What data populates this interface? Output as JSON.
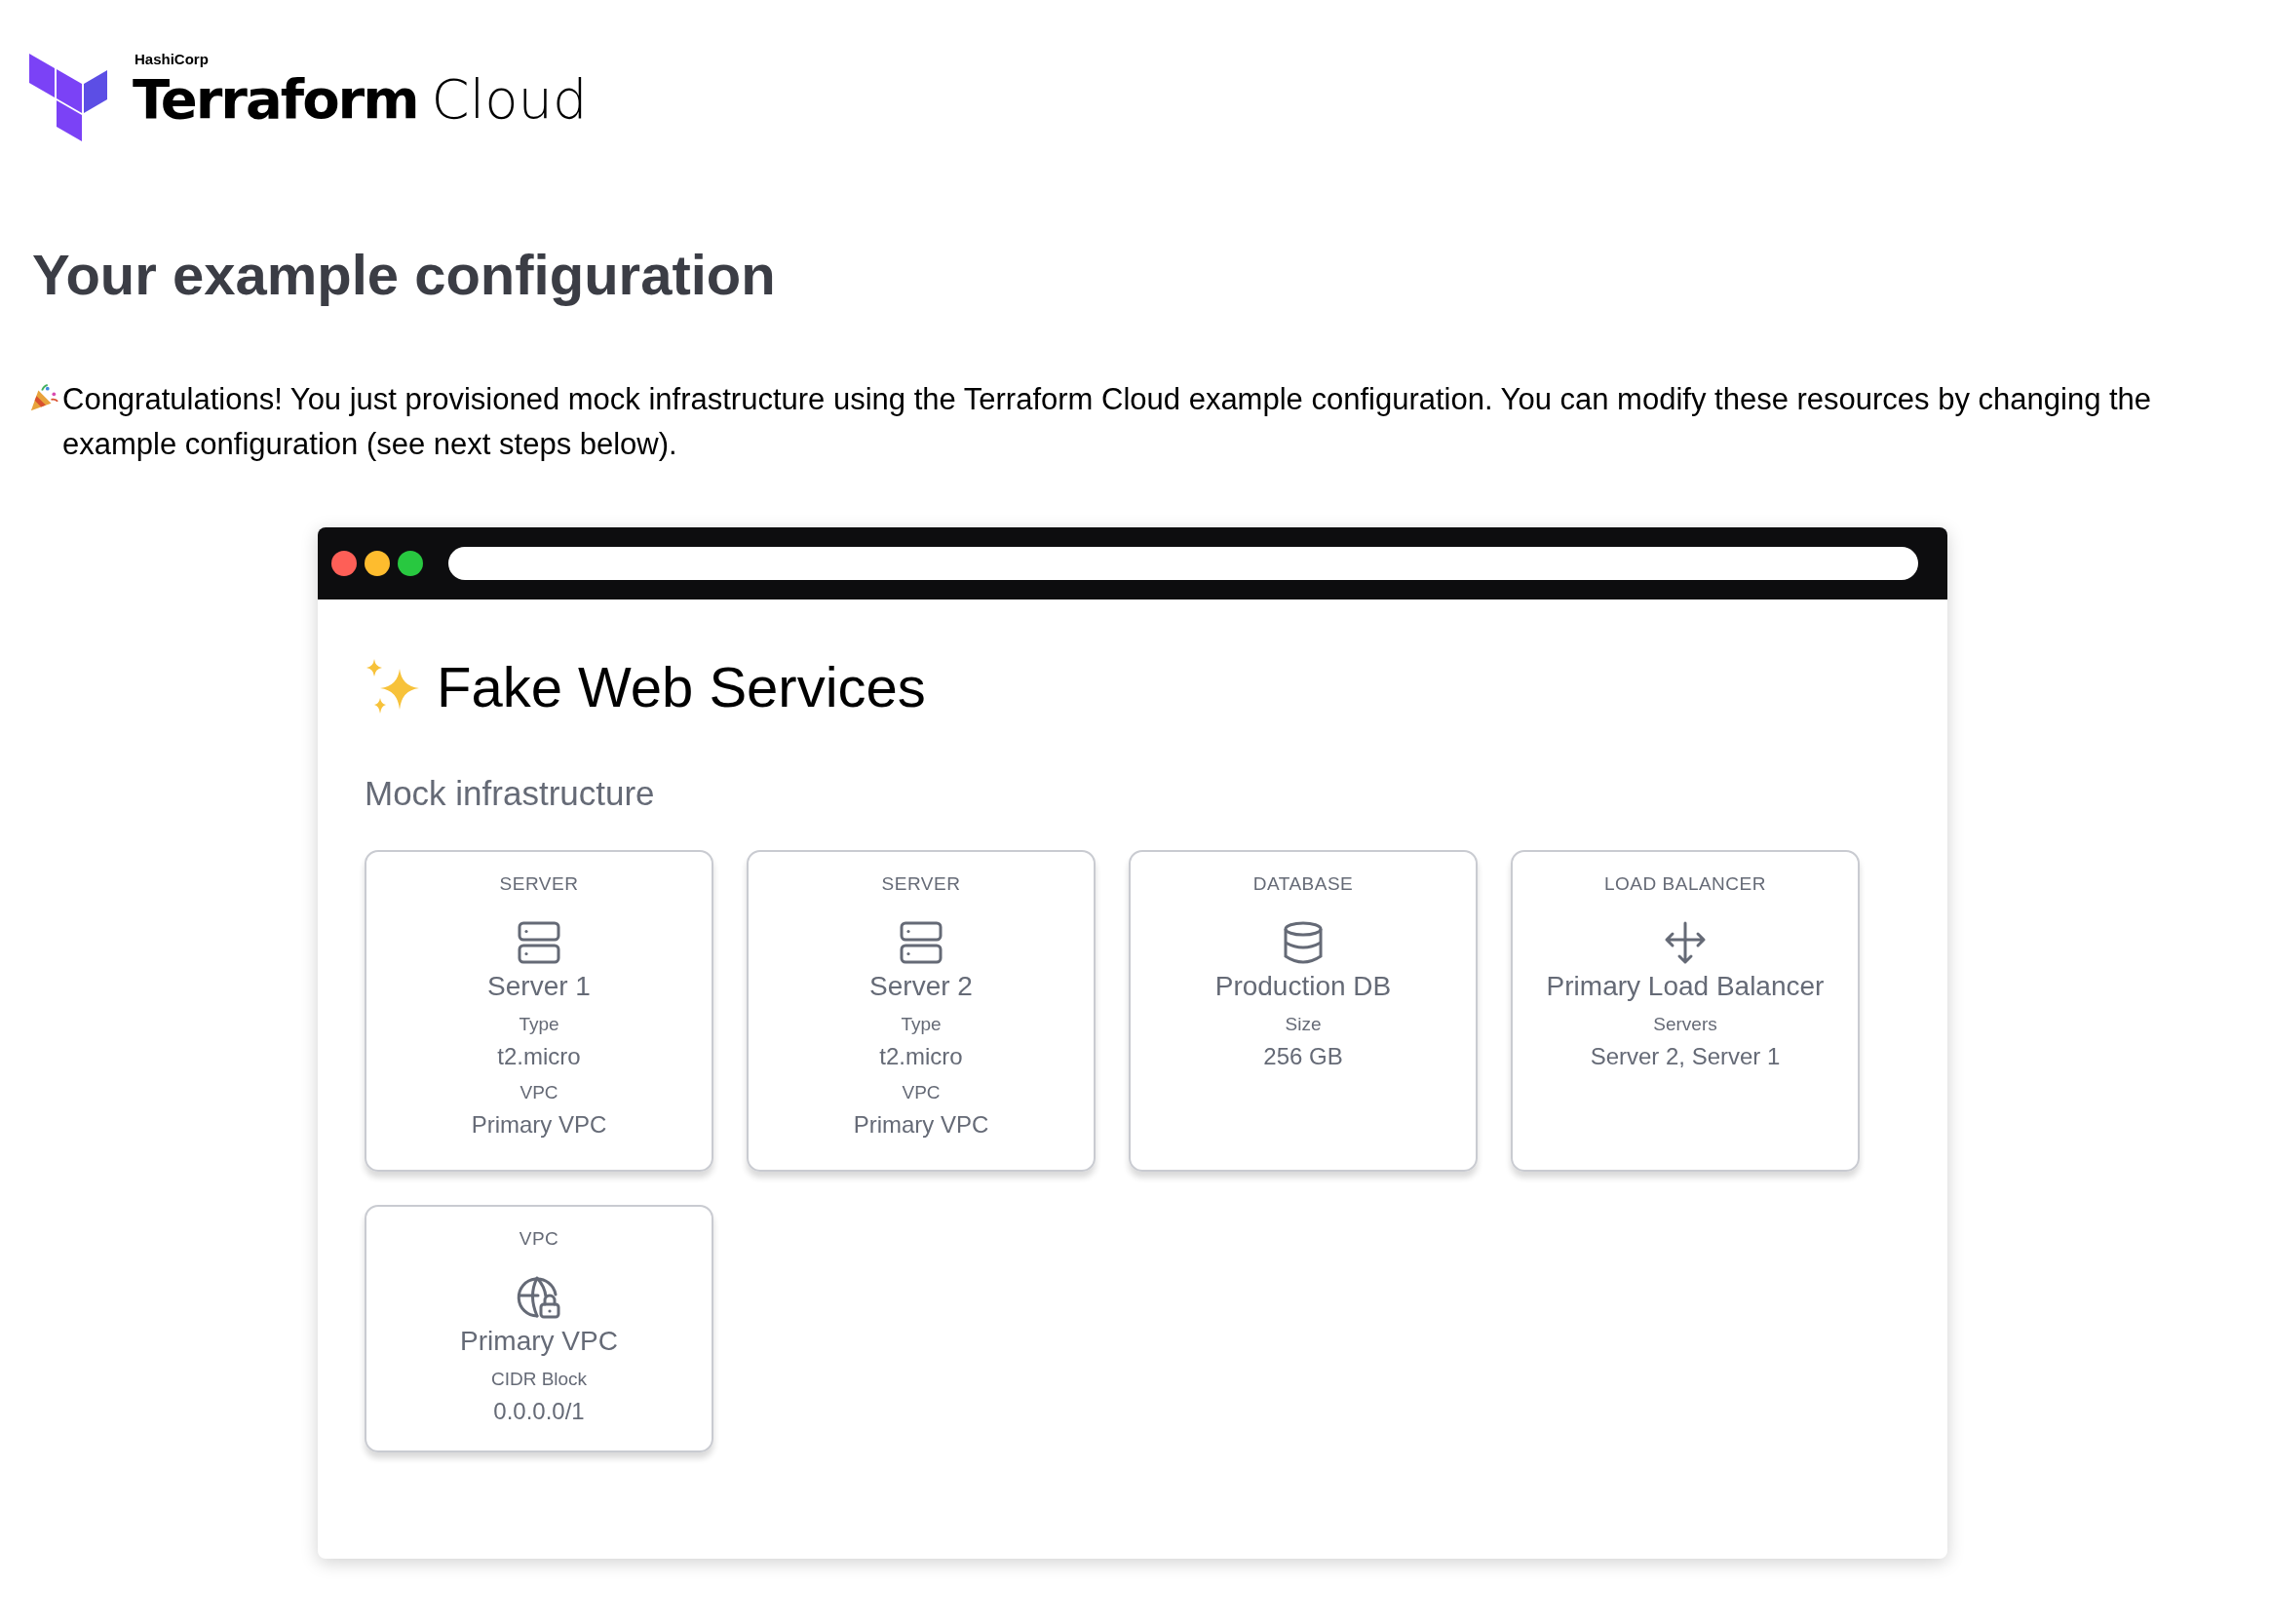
{
  "logo": {
    "company": "HashiCorp",
    "product": "Terraform",
    "edition": "Cloud"
  },
  "heading": "Your example configuration",
  "intro": "Congratulations! You just provisioned mock infrastructure using the Terraform Cloud example configuration. You can modify these resources by changing the example configuration (see next steps below).",
  "browser": {
    "title": "Fake Web Services",
    "section": "Mock infrastructure",
    "resources": [
      {
        "kind": "server",
        "category": "SERVER",
        "name": "Server 1",
        "fields": [
          {
            "label": "Type",
            "value": "t2.micro"
          },
          {
            "label": "VPC",
            "value": "Primary VPC"
          }
        ]
      },
      {
        "kind": "server",
        "category": "SERVER",
        "name": "Server 2",
        "fields": [
          {
            "label": "Type",
            "value": "t2.micro"
          },
          {
            "label": "VPC",
            "value": "Primary VPC"
          }
        ]
      },
      {
        "kind": "database",
        "category": "DATABASE",
        "name": "Production DB",
        "fields": [
          {
            "label": "Size",
            "value": "256 GB"
          }
        ]
      },
      {
        "kind": "load_balancer",
        "category": "LOAD BALANCER",
        "name": "Primary Load Balancer",
        "fields": [
          {
            "label": "Servers",
            "value": "Server 2, Server 1"
          }
        ]
      },
      {
        "kind": "vpc",
        "category": "VPC",
        "name": "Primary VPC",
        "fields": [
          {
            "label": "CIDR Block",
            "value": "0.0.0.0/1"
          }
        ]
      }
    ]
  }
}
